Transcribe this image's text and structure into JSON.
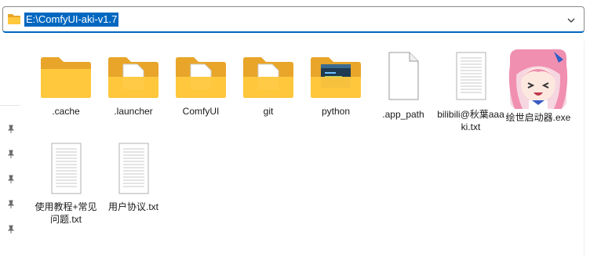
{
  "address_bar": {
    "path": "E:\\ComfyUI-aki-v1.7"
  },
  "items": [
    {
      "name": ".cache",
      "type": "folder-empty"
    },
    {
      "name": ".launcher",
      "type": "folder-doc"
    },
    {
      "name": "ComfyUI",
      "type": "folder-doc"
    },
    {
      "name": "git",
      "type": "folder-doc"
    },
    {
      "name": "python",
      "type": "folder-app"
    },
    {
      "name": ".app_path",
      "type": "file-blank"
    },
    {
      "name": "bilibili@秋葉aaaki.txt",
      "type": "file-text"
    },
    {
      "name": "绘世启动器.exe",
      "type": "exe-anime"
    },
    {
      "name": "使用教程+常见问题.txt",
      "type": "file-text"
    },
    {
      "name": "用户协议.txt",
      "type": "file-text"
    }
  ],
  "colors": {
    "folder_back": "#e8a52a",
    "folder_front": "#ffc83d",
    "accent": "#0067c0"
  }
}
